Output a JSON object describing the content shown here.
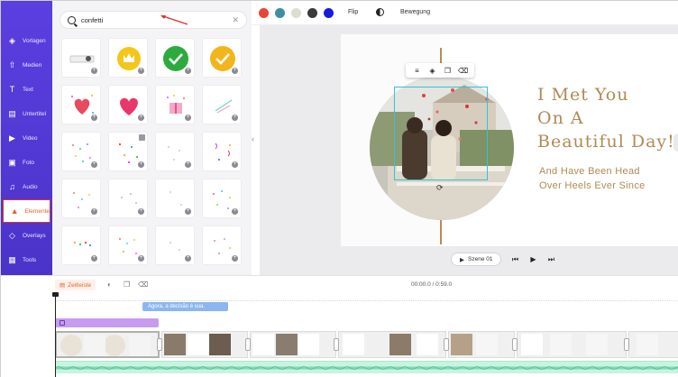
{
  "sidebar": {
    "items": [
      {
        "label": "Vorlagen",
        "icon": "layers-icon"
      },
      {
        "label": "Medien",
        "icon": "upload-icon"
      },
      {
        "label": "Text",
        "icon": "text-icon"
      },
      {
        "label": "Untertitel",
        "icon": "subtitles-icon"
      },
      {
        "label": "Video",
        "icon": "video-icon"
      },
      {
        "label": "Foto",
        "icon": "photo-icon"
      },
      {
        "label": "Audio",
        "icon": "music-icon"
      },
      {
        "label": "Elemente",
        "icon": "elements-icon"
      },
      {
        "label": "Overlays",
        "icon": "overlays-icon"
      },
      {
        "label": "Tools",
        "icon": "toolbox-icon"
      }
    ],
    "active": "Elemente"
  },
  "search": {
    "value": "confetti"
  },
  "toolbar": {
    "swatches": [
      "#e64538",
      "#3d8ea0",
      "#dcdcd0",
      "#3a3a3a",
      "#1a1adc"
    ],
    "flip_label": "Flip",
    "motion_label": "Bewegung"
  },
  "canvas": {
    "headline": [
      "I Met You",
      "On A",
      "Beautiful Day!"
    ],
    "subline": [
      "And Have Been Head",
      "Over Heels Ever Since"
    ],
    "accent_color": "#b08a55"
  },
  "playbar": {
    "scene_label": "Szene 01"
  },
  "timeline": {
    "tab_label": "Zeitleiste",
    "time": "00:00.0 / 0:59.0",
    "subtitle_text": "Agora, a decisão é sua."
  },
  "elements_grid": [
    "sticker",
    "crown-badge",
    "green-check",
    "gold-check",
    "heart-confetti",
    "pink-heart",
    "gift-box",
    "streamer",
    "confetti-1",
    "confetti-2",
    "confetti-3",
    "confetti-4",
    "confetti-5",
    "confetti-6",
    "confetti-7",
    "confetti-8",
    "confetti-9",
    "confetti-10",
    "confetti-11",
    "confetti-12"
  ]
}
